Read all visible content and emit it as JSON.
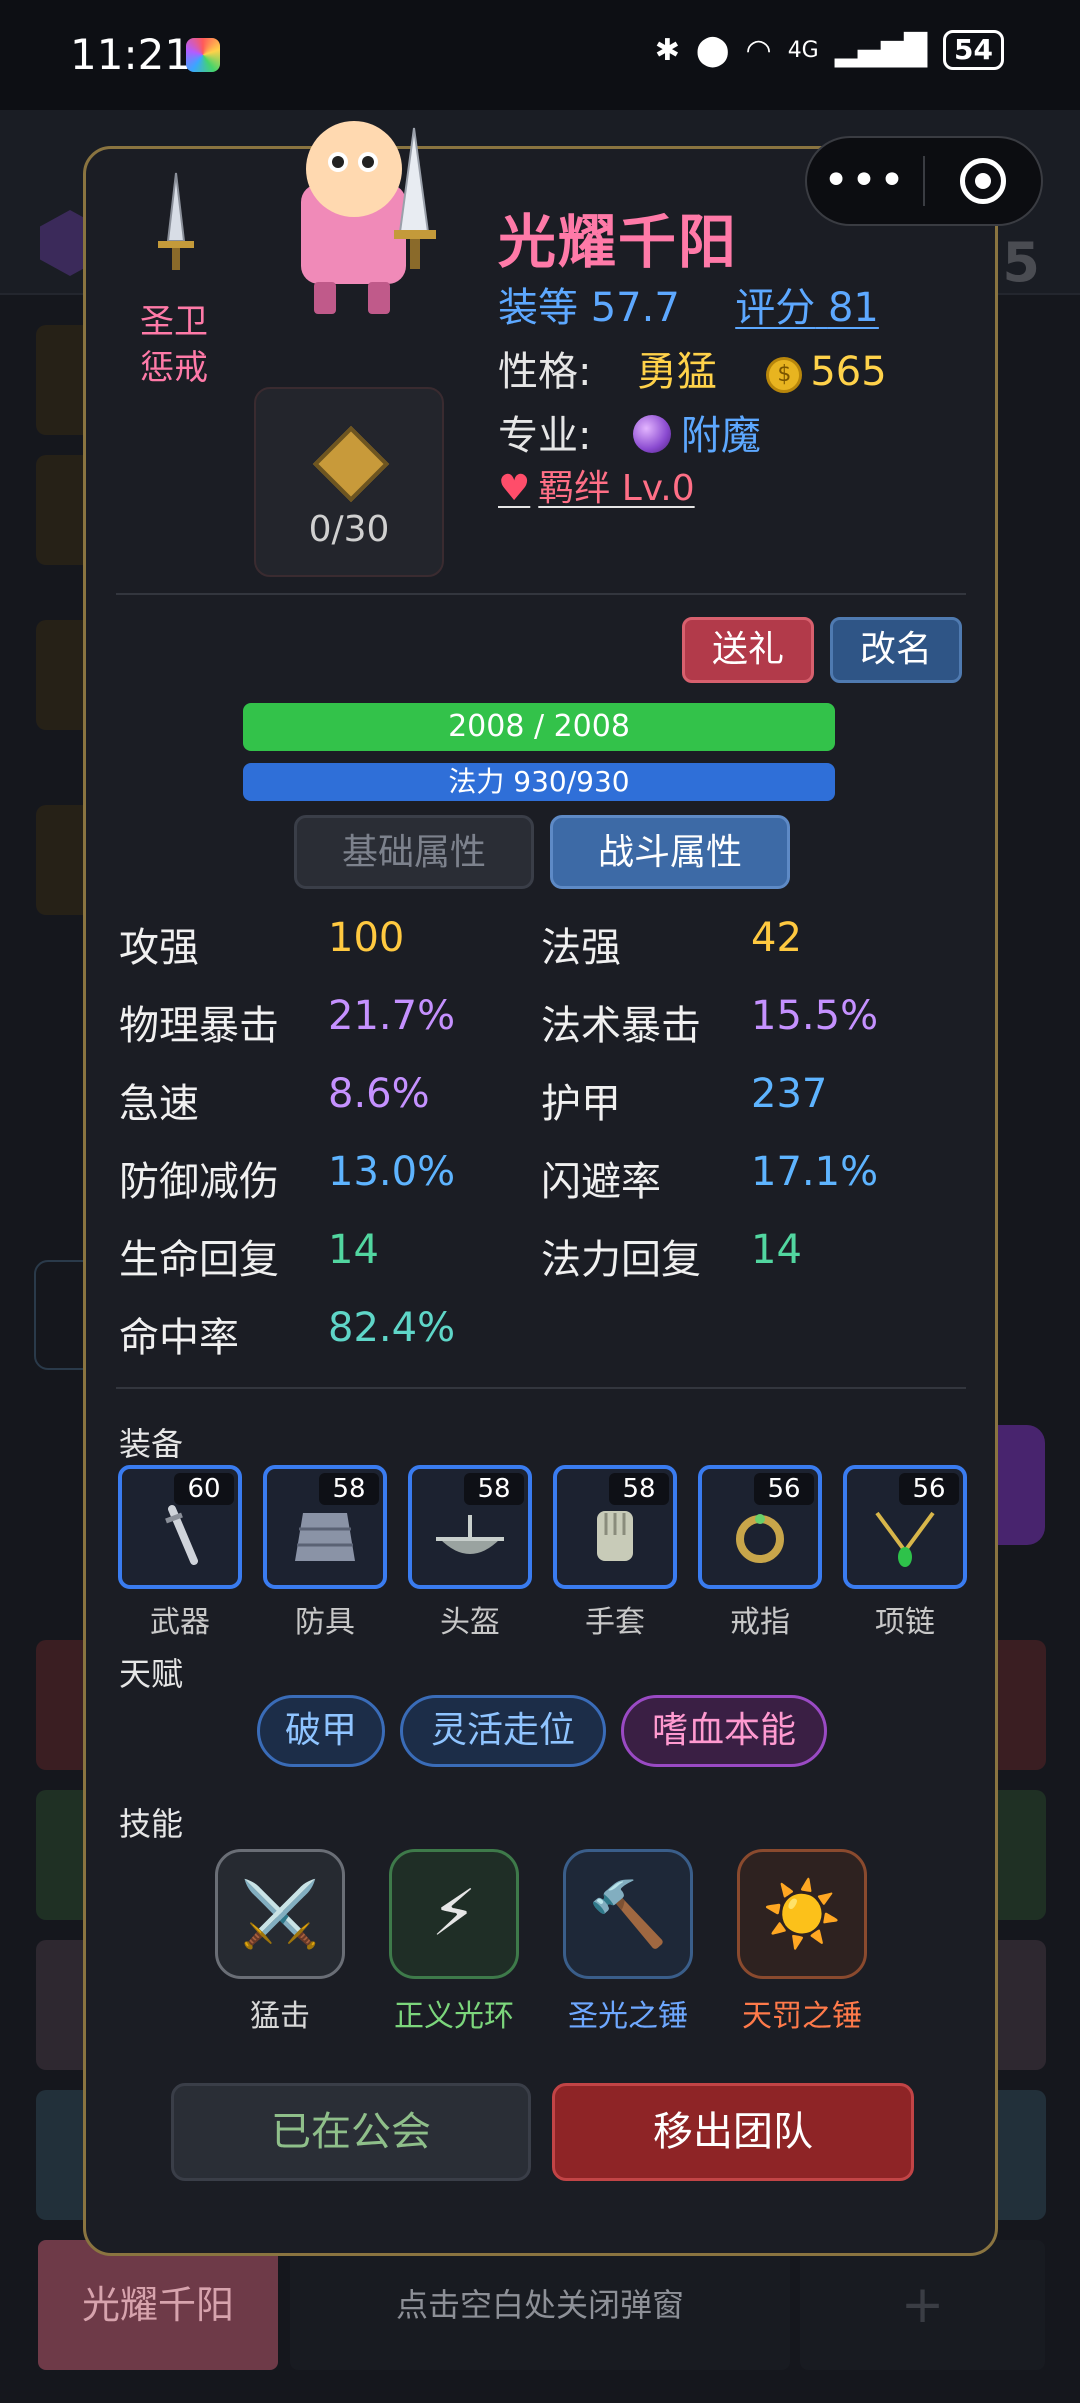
{
  "status_bar": {
    "time": "11:21",
    "battery": "54",
    "network": "4G"
  },
  "background": {
    "level_text": "指挥 Lv.5",
    "bottom_name": "光耀千阳",
    "close_hint": "点击空白处关闭弹窗",
    "add_symbol": "+"
  },
  "capsule": {
    "more": "•••"
  },
  "hero": {
    "title": "圣卫惩戒",
    "name": "光耀千阳",
    "gear_score_label": "装等",
    "gear_score": "57.7",
    "rating_label": "评分",
    "rating": "81",
    "personality_label": "性格:",
    "personality": "勇猛",
    "gold": "565",
    "profession_label": "专业:",
    "profession": "附魔",
    "bond": "羁绊 Lv.0",
    "xp": "0/30"
  },
  "actions": {
    "gift": "送礼",
    "rename": "改名"
  },
  "bars": {
    "hp": "2008 / 2008",
    "hp_fraction": 1.0,
    "mp": "法力 930/930",
    "mp_fraction": 1.0
  },
  "tabs": {
    "basic": "基础属性",
    "combat": "战斗属性",
    "active": "combat"
  },
  "stats": [
    {
      "label": "攻强",
      "value": "100",
      "color": "gold"
    },
    {
      "label": "法强",
      "value": "42",
      "color": "gold"
    },
    {
      "label": "物理暴击",
      "value": "21.7%",
      "color": "purple"
    },
    {
      "label": "法术暴击",
      "value": "15.5%",
      "color": "purple"
    },
    {
      "label": "急速",
      "value": "8.6%",
      "color": "purple"
    },
    {
      "label": "护甲",
      "value": "237",
      "color": "blue"
    },
    {
      "label": "防御减伤",
      "value": "13.0%",
      "color": "blue"
    },
    {
      "label": "闪避率",
      "value": "17.1%",
      "color": "blue"
    },
    {
      "label": "生命回复",
      "value": "14",
      "color": "green"
    },
    {
      "label": "法力回复",
      "value": "14",
      "color": "green"
    },
    {
      "label": "命中率",
      "value": "82.4%",
      "color": "teal"
    }
  ],
  "equipment": {
    "section": "装备",
    "items": [
      {
        "name": "武器",
        "level": "60",
        "icon": "sword-icon"
      },
      {
        "name": "防具",
        "level": "58",
        "icon": "armor-icon"
      },
      {
        "name": "头盔",
        "level": "58",
        "icon": "helmet-icon"
      },
      {
        "name": "手套",
        "level": "58",
        "icon": "glove-icon"
      },
      {
        "name": "戒指",
        "level": "56",
        "icon": "ring-icon"
      },
      {
        "name": "项链",
        "level": "56",
        "icon": "necklace-icon"
      }
    ]
  },
  "talents": {
    "section": "天赋",
    "items": [
      "破甲",
      "灵活走位",
      "嗜血本能"
    ]
  },
  "skills": {
    "section": "技能",
    "items": [
      {
        "name": "猛击",
        "glyph": "⚔️",
        "color": "#d8d8d8"
      },
      {
        "name": "正义光环",
        "glyph": "⚡",
        "color": "#7cd67c"
      },
      {
        "name": "圣光之锤",
        "glyph": "🔨",
        "color": "#6ea8ff"
      },
      {
        "name": "天罚之锤",
        "glyph": "☀️",
        "color": "#ff7a4a"
      }
    ]
  },
  "footer": {
    "guild": "已在公会",
    "leave": "移出团队"
  }
}
